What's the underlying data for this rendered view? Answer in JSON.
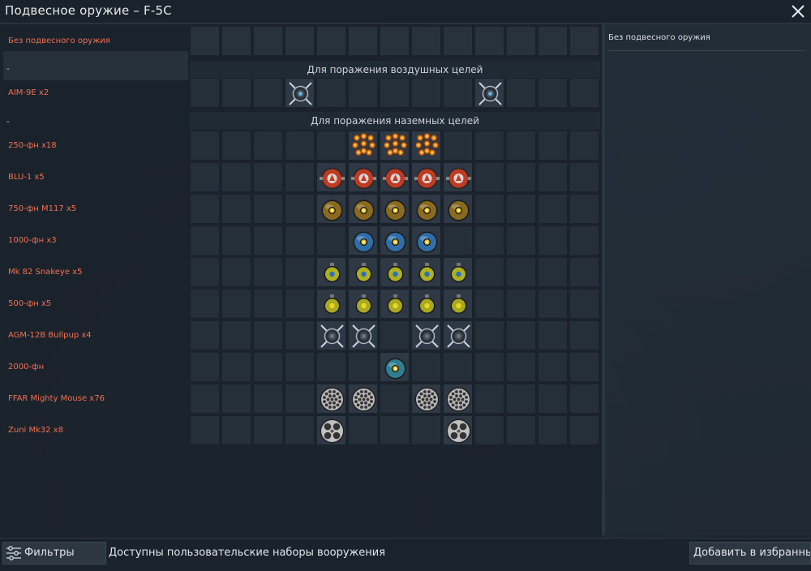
{
  "window": {
    "title": "Подвесное оружие – F-5C"
  },
  "selected_preset": {
    "label": "Без подвесного оружия"
  },
  "sections": {
    "air": "Для поражения воздушных целей",
    "ground": "Для поражения наземных целей",
    "dash": "-"
  },
  "rows": [
    {
      "label": "AIM-9E x2",
      "icon": "missile-aa-icon",
      "slots": [
        3,
        9
      ]
    },
    {
      "label": "250-фн x18",
      "icon": "bomb-cluster-icon",
      "slots": [
        5,
        6,
        7
      ]
    },
    {
      "label": "BLU-1 x5",
      "icon": "incendiary-bomb-icon",
      "slots": [
        4,
        5,
        6,
        7,
        8
      ]
    },
    {
      "label": "750-фн M117 x5",
      "icon": "bomb-750-icon",
      "slots": [
        4,
        5,
        6,
        7,
        8
      ]
    },
    {
      "label": "1000-фн x3",
      "icon": "bomb-1000-icon",
      "slots": [
        5,
        6,
        7
      ]
    },
    {
      "label": "Mk 82 Snakeye x5",
      "icon": "snakeye-bomb-icon",
      "slots": [
        4,
        5,
        6,
        7,
        8
      ]
    },
    {
      "label": "500-фн x5",
      "icon": "bomb-500-icon",
      "slots": [
        4,
        5,
        6,
        7,
        8
      ]
    },
    {
      "label": "AGM-12B Bullpup x4",
      "icon": "missile-ag-icon",
      "slots": [
        4,
        5,
        7,
        8
      ]
    },
    {
      "label": "2000-фн",
      "icon": "bomb-2000-icon",
      "slots": [
        6
      ]
    },
    {
      "label": "FFAR Mighty Mouse x76",
      "icon": "rocket-pod-19-icon",
      "slots": [
        4,
        5,
        7,
        8
      ]
    },
    {
      "label": "Zuni Mk32 x8",
      "icon": "rocket-pod-4-icon",
      "slots": [
        4,
        8
      ]
    }
  ],
  "right_panel": {
    "title": "Без подвесного оружия"
  },
  "bottom": {
    "filters_label": "Фильтры",
    "custom_text": "Доступны пользовательские наборы вооружения",
    "favorites_label": "Добавить в избранные"
  },
  "colors": {
    "label_red": "#f07050",
    "background": "#1d2630",
    "accent_yellow": "#d8d020",
    "accent_blue": "#3a7fc0"
  }
}
